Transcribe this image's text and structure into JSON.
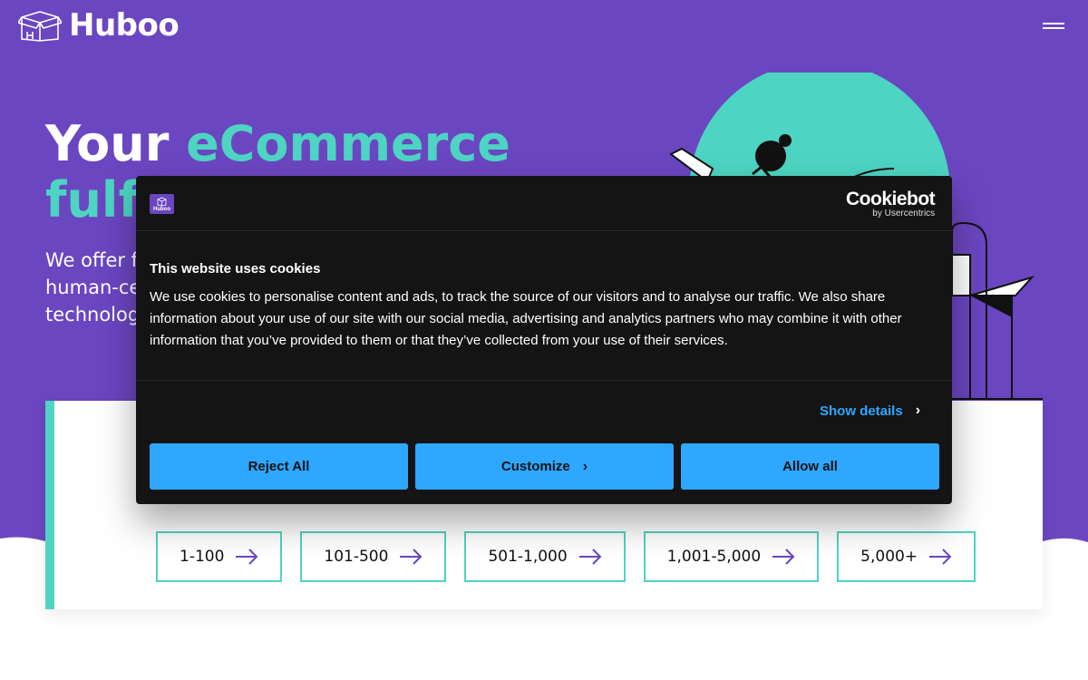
{
  "brand": {
    "name": "Huboo"
  },
  "colors": {
    "purple": "#6b46c1",
    "teal": "#4dd4c2",
    "cookie_bg": "#141414",
    "cookie_button": "#2ea7ff"
  },
  "hero": {
    "headline_line1_prefix": "Your ",
    "headline_line1_accent": "eCommerce",
    "headline_line2_visible": "fulfi",
    "subtext_visible": [
      "We offer fu",
      "human-ce",
      "technolog"
    ]
  },
  "order_ranges": [
    {
      "label": "1-100"
    },
    {
      "label": "101-500"
    },
    {
      "label": "501-1,000"
    },
    {
      "label": "1,001-5,000"
    },
    {
      "label": "5,000+"
    }
  ],
  "cookie_banner": {
    "logo_label": "Huboo",
    "provider_name": "Cookiebot",
    "provider_sub": "by Usercentrics",
    "title": "This website uses cookies",
    "body": "We use cookies to personalise content and ads, to track the source of our visitors and to analyse our traffic. We also share information about your use of our site with our social media, advertising and analytics partners who may combine it with other information that you’ve provided to them or that they’ve collected from your use of their services.",
    "show_details": "Show details",
    "buttons": {
      "reject": "Reject All",
      "customize": "Customize",
      "allow": "Allow all"
    }
  },
  "icons": {
    "logo": "box-icon",
    "menu": "hamburger-menu-icon",
    "arrow": "arrow-right-icon",
    "chevron": "chevron-right-icon"
  }
}
